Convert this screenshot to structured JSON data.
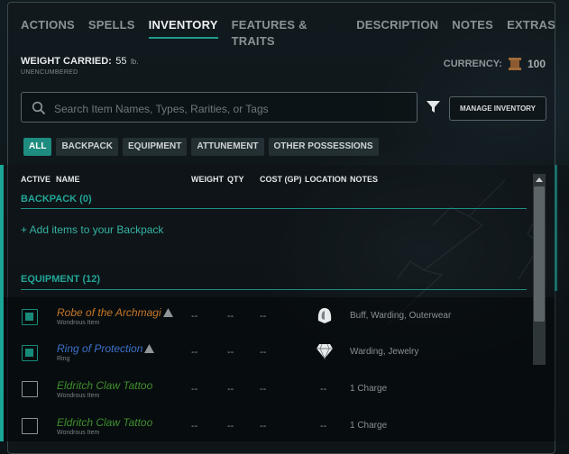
{
  "tabs": [
    "ACTIONS",
    "SPELLS",
    "INVENTORY",
    "FEATURES & TRAITS",
    "DESCRIPTION",
    "NOTES",
    "EXTRAS"
  ],
  "weight": {
    "label": "WEIGHT CARRIED:",
    "value": "55",
    "unit": "lb.",
    "status": "UNENCUMBERED"
  },
  "currency": {
    "label": "CURRENCY:",
    "amount": "100",
    "icon": "coin-stack-icon"
  },
  "search": {
    "placeholder": "Search Item Names, Types, Rarities, or Tags"
  },
  "manage_label": "MANAGE INVENTORY",
  "filters": [
    "ALL",
    "BACKPACK",
    "EQUIPMENT",
    "ATTUNEMENT",
    "OTHER POSSESSIONS"
  ],
  "columns": {
    "active": "ACTIVE",
    "name": "NAME",
    "weight": "WEIGHT",
    "qty": "QTY",
    "cost": "COST (GP)",
    "location": "LOCATION",
    "notes": "NOTES"
  },
  "backpack": {
    "title": "BACKPACK (0)",
    "add_link": "+ Add items to your Backpack"
  },
  "equipment": {
    "title": "EQUIPMENT (12)",
    "items": [
      {
        "name": "Robe of the Archmagi",
        "type": "Wondrous Item",
        "color": "#c77829",
        "active": true,
        "warning": true,
        "weight": "--",
        "qty": "--",
        "cost": "--",
        "location_icon": "cloak-icon",
        "notes": "Buff, Warding, Outerwear"
      },
      {
        "name": "Ring of Protection",
        "type": "Ring",
        "color": "#3b72c9",
        "active": true,
        "warning": true,
        "weight": "--",
        "qty": "--",
        "cost": "--",
        "location_icon": "gem-icon",
        "notes": "Warding, Jewelry"
      },
      {
        "name": "Eldritch Claw Tattoo",
        "type": "Wondrous Item",
        "color": "#3f8f2e",
        "active": false,
        "warning": false,
        "weight": "--",
        "qty": "--",
        "cost": "--",
        "location": "--",
        "notes": "1 Charge"
      },
      {
        "name": "Eldritch Claw Tattoo",
        "type": "Wondrous Item",
        "color": "#3f8f2e",
        "active": false,
        "warning": false,
        "weight": "--",
        "qty": "--",
        "cost": "--",
        "location": "--",
        "notes": "1 Charge"
      }
    ]
  },
  "colors": {
    "accent": "#1e8c7f",
    "section": "#22a596"
  }
}
